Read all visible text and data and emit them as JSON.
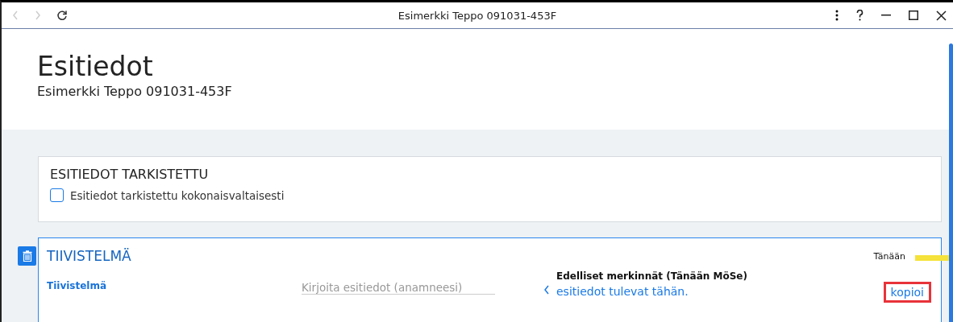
{
  "window": {
    "title": "Esimerkki Teppo 091031-453F"
  },
  "header": {
    "title": "Esitiedot",
    "subtitle": "Esimerkki Teppo 091031-453F"
  },
  "review_card": {
    "title": "ESITIEDOT TARKISTETTU",
    "checkbox": {
      "label": "Esitiedot tarkistettu kokonaisvaltaisesti",
      "checked": false
    }
  },
  "summary_card": {
    "title": "TIIVISTELMÄ",
    "field_label": "Tiivistelmä",
    "placeholder": "Kirjoita esitiedot (anamneesi)",
    "timeline_label": "Tänään",
    "previous_title": "Edelliset merkinnät (Tänään MöSe)",
    "previous_text": "esitiedot tulevat tähän.",
    "copy_link": "kopioi"
  }
}
